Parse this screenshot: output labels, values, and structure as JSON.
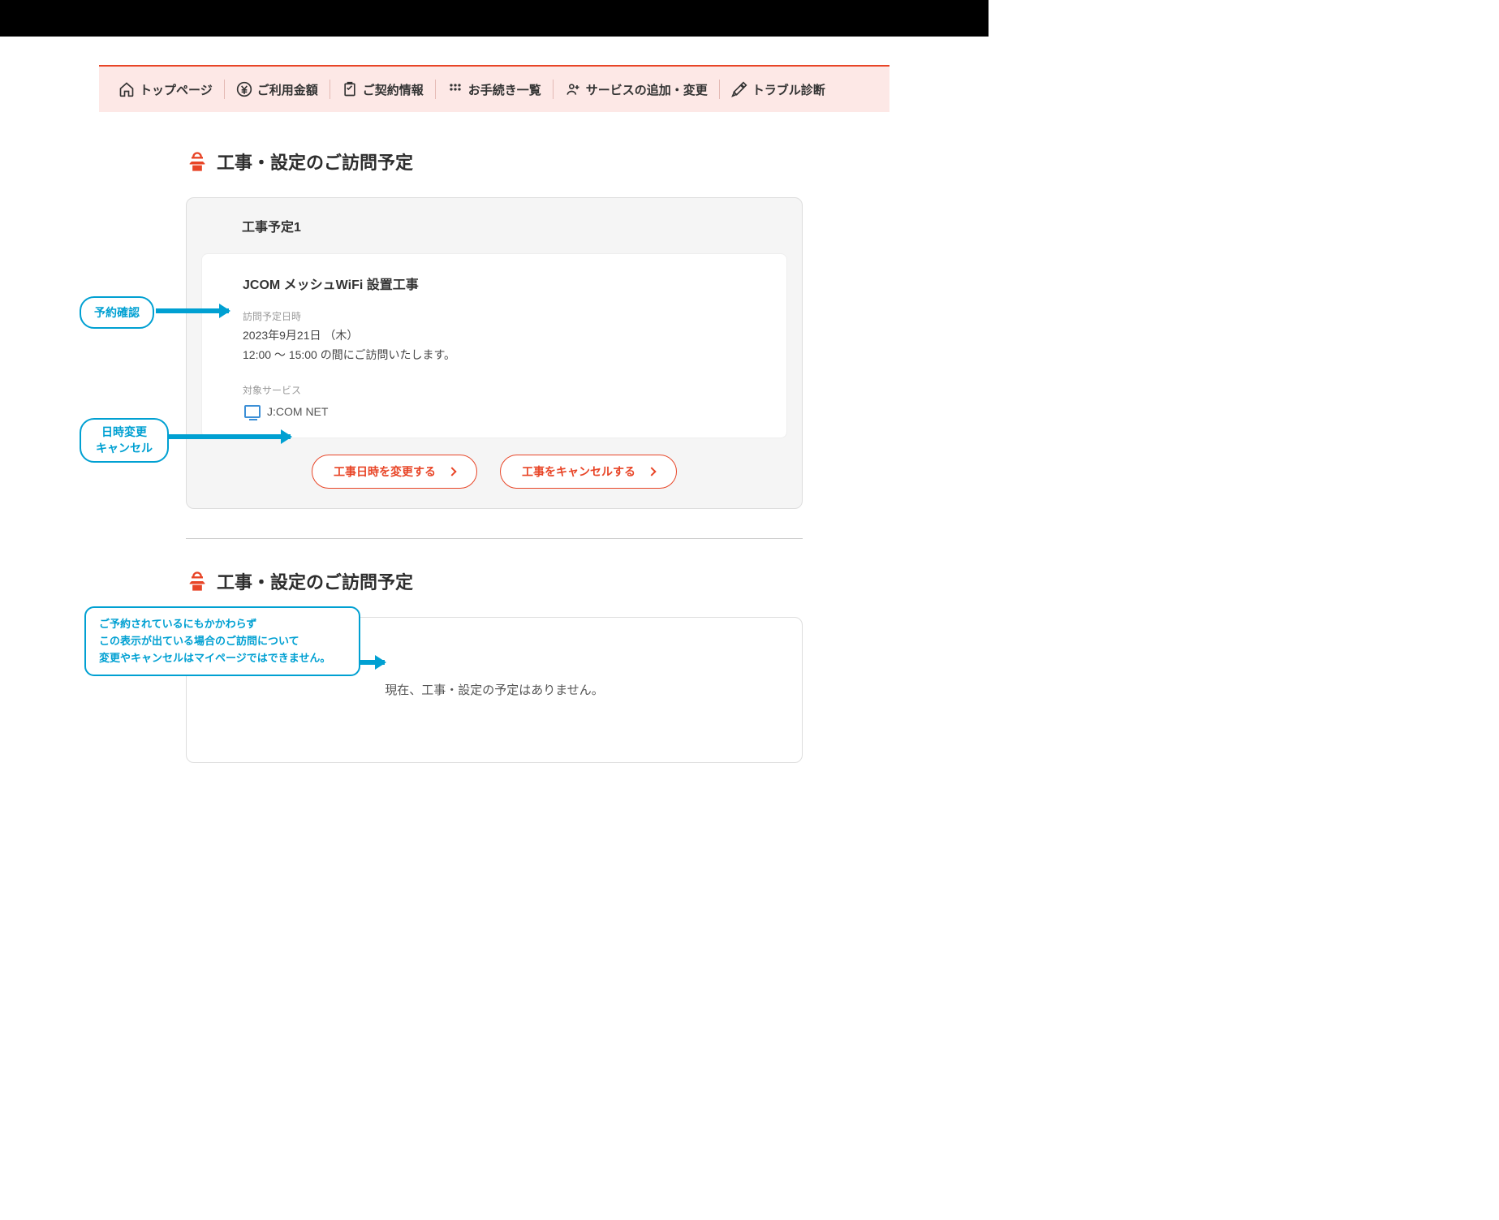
{
  "nav": {
    "items": [
      {
        "label": "トップページ"
      },
      {
        "label": "ご利用金額"
      },
      {
        "label": "ご契約情報"
      },
      {
        "label": "お手続き一覧"
      },
      {
        "label": "サービスの追加・変更"
      },
      {
        "label": "トラブル診断"
      }
    ]
  },
  "section1": {
    "title": "工事・設定のご訪問予定",
    "schedule_heading": "工事予定1",
    "job_title": "JCOM メッシュWiFi 設置工事",
    "visit_label": "訪問予定日時",
    "visit_date": "2023年9月21日 （木）",
    "visit_time": "12:00 〜 15:00 の間にご訪問いたします。",
    "service_label": "対象サービス",
    "service_name": "J:COM NET",
    "btn_change": "工事日時を変更する",
    "btn_cancel": "工事をキャンセルする"
  },
  "section2": {
    "title": "工事・設定のご訪問予定",
    "empty_msg": "現在、工事・設定の予定はありません。"
  },
  "annotations": {
    "confirm": "予約確認",
    "change_line1": "日時変更",
    "change_line2": "キャンセル",
    "warn_line1": "ご予約されているにもかかわらず",
    "warn_line2": "この表示が出ている場合のご訪問について",
    "warn_line3": "変更やキャンセルはマイページではできません。"
  }
}
